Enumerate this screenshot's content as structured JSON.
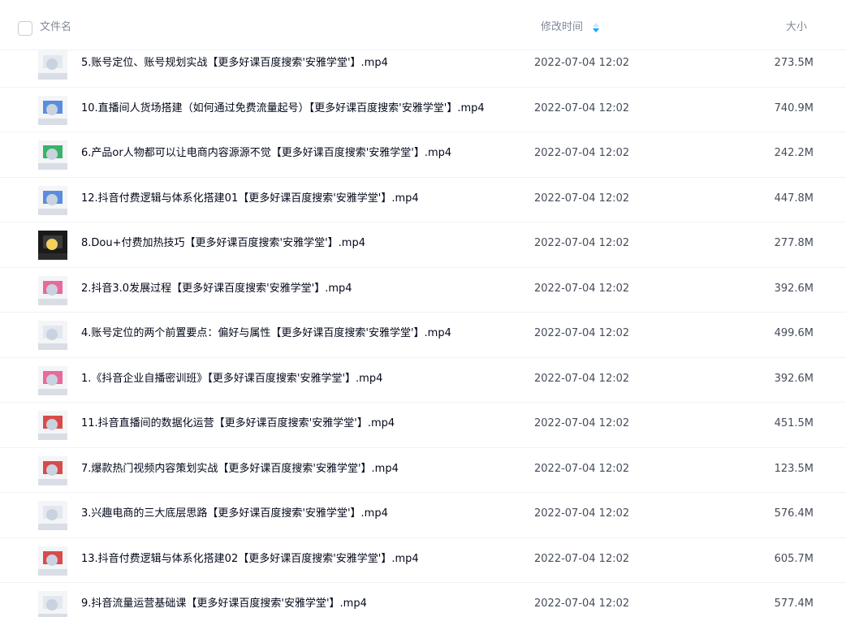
{
  "header": {
    "name_label": "文件名",
    "time_label": "修改时间",
    "size_label": "大小"
  },
  "colors": {
    "accent": "#06a7ff",
    "header_text": "#818999",
    "row_divider": "#f0f2f5"
  },
  "files": [
    {
      "name": "5.账号定位、账号规划实战【更多好课百度搜索'安雅学堂'】.mp4",
      "time": "2022-07-04 12:02",
      "size": "273.5M",
      "thumb_icon": "video-thumbnail-icon"
    },
    {
      "name": "10.直播间人货场搭建（如何通过免费流量起号）【更多好课百度搜索'安雅学堂'】.mp4",
      "time": "2022-07-04 12:02",
      "size": "740.9M",
      "thumb_icon": "video-thumbnail-icon"
    },
    {
      "name": "6.产品or人物都可以让电商内容源源不觉【更多好课百度搜索'安雅学堂'】.mp4",
      "time": "2022-07-04 12:02",
      "size": "242.2M",
      "thumb_icon": "video-thumbnail-icon"
    },
    {
      "name": "12.抖音付费逻辑与体系化搭建01【更多好课百度搜索'安雅学堂'】.mp4",
      "time": "2022-07-04 12:02",
      "size": "447.8M",
      "thumb_icon": "video-thumbnail-icon"
    },
    {
      "name": "8.Dou+付费加热技巧【更多好课百度搜索'安雅学堂'】.mp4",
      "time": "2022-07-04 12:02",
      "size": "277.8M",
      "thumb_icon": "video-thumbnail-icon"
    },
    {
      "name": "2.抖音3.0发展过程【更多好课百度搜索'安雅学堂'】.mp4",
      "time": "2022-07-04 12:02",
      "size": "392.6M",
      "thumb_icon": "video-thumbnail-icon"
    },
    {
      "name": "4.账号定位的两个前置要点：偏好与属性【更多好课百度搜索'安雅学堂'】.mp4",
      "time": "2022-07-04 12:02",
      "size": "499.6M",
      "thumb_icon": "video-thumbnail-icon"
    },
    {
      "name": "1.《抖音企业自播密训班》【更多好课百度搜索'安雅学堂'】.mp4",
      "time": "2022-07-04 12:02",
      "size": "392.6M",
      "thumb_icon": "video-thumbnail-icon"
    },
    {
      "name": "11.抖音直播间的数据化运营【更多好课百度搜索'安雅学堂'】.mp4",
      "time": "2022-07-04 12:02",
      "size": "451.5M",
      "thumb_icon": "video-thumbnail-icon"
    },
    {
      "name": "7.爆款热门视频内容策划实战【更多好课百度搜索'安雅学堂'】.mp4",
      "time": "2022-07-04 12:02",
      "size": "123.5M",
      "thumb_icon": "video-thumbnail-icon"
    },
    {
      "name": "3.兴趣电商的三大底层思路【更多好课百度搜索'安雅学堂'】.mp4",
      "time": "2022-07-04 12:02",
      "size": "576.4M",
      "thumb_icon": "video-thumbnail-icon"
    },
    {
      "name": "13.抖音付费逻辑与体系化搭建02【更多好课百度搜索'安雅学堂'】.mp4",
      "time": "2022-07-04 12:02",
      "size": "605.7M",
      "thumb_icon": "video-thumbnail-icon"
    },
    {
      "name": "9.抖音流量运营基础课【更多好课百度搜索'安雅学堂'】.mp4",
      "time": "2022-07-04 12:02",
      "size": "577.4M",
      "thumb_icon": "video-thumbnail-icon"
    }
  ]
}
